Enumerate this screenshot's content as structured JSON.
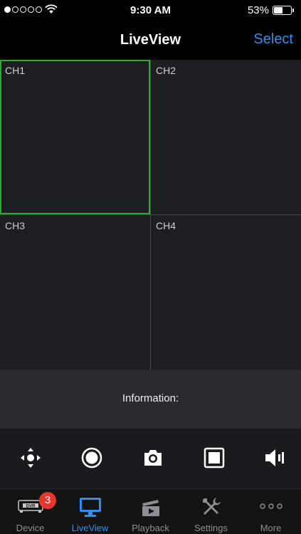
{
  "status_bar": {
    "time": "9:30 AM",
    "battery_percent": "53%",
    "battery_level": 0.53,
    "signal_bars_filled": 1,
    "signal_bars_total": 5
  },
  "nav": {
    "title": "LiveView",
    "select_label": "Select"
  },
  "channels": [
    {
      "label": "CH1",
      "selected": true
    },
    {
      "label": "CH2",
      "selected": false
    },
    {
      "label": "CH3",
      "selected": false
    },
    {
      "label": "CH4",
      "selected": false
    }
  ],
  "info": {
    "label": "Information:"
  },
  "controls": [
    {
      "icon": "ptz-direction-icon"
    },
    {
      "icon": "record-icon"
    },
    {
      "icon": "camera-icon"
    },
    {
      "icon": "stop-icon"
    },
    {
      "icon": "speaker-icon"
    }
  ],
  "tabs": [
    {
      "label": "Device",
      "icon": "dvr-icon",
      "badge": "3",
      "icon_text": "DVR"
    },
    {
      "label": "LiveView",
      "icon": "monitor-icon",
      "active": true
    },
    {
      "label": "Playback",
      "icon": "playback-icon"
    },
    {
      "label": "Settings",
      "icon": "tools-icon"
    },
    {
      "label": "More",
      "icon": "more-icon"
    }
  ],
  "colors": {
    "accent": "#2f8ff0",
    "selected_border": "#28b02b",
    "badge": "#e8362f"
  }
}
